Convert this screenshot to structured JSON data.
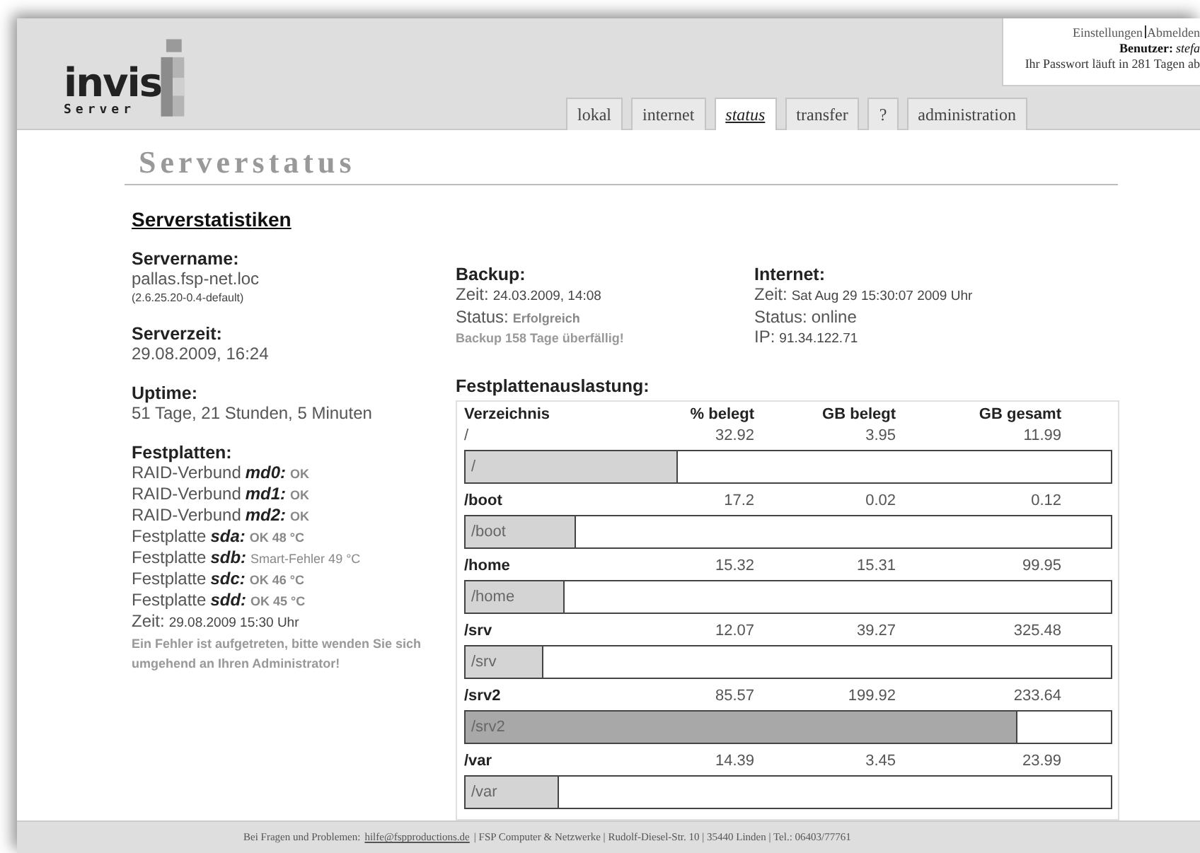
{
  "user_box": {
    "links": [
      "Einstellungen",
      "Abmelden"
    ],
    "user_label": "Benutzer:",
    "user_name": "stefa",
    "password_note": "Ihr Passwort läuft in 281 Tagen ab"
  },
  "logo": {
    "name": "invis",
    "sub": "Server"
  },
  "tabs": [
    {
      "label": "lokal",
      "selected": false
    },
    {
      "label": "internet",
      "selected": false
    },
    {
      "label": "status",
      "selected": true
    },
    {
      "label": "transfer",
      "selected": false
    },
    {
      "label": "?",
      "selected": false
    },
    {
      "label": "administration",
      "selected": false
    }
  ],
  "page_title": "Serverstatus",
  "section_title": "Serverstatistiken",
  "servername": {
    "heading": "Servername:",
    "value": "pallas.fsp-net.loc",
    "kernel": "(2.6.25.20-0.4-default)"
  },
  "serverzeit": {
    "heading": "Serverzeit:",
    "value": "29.08.2009, 16:24"
  },
  "uptime": {
    "heading": "Uptime:",
    "value": "51 Tage, 21 Stunden, 5 Minuten"
  },
  "disks": {
    "heading": "Festplatten:",
    "items": [
      {
        "label": "RAID-Verbund",
        "device": "md0:",
        "status": "OK",
        "error": false
      },
      {
        "label": "RAID-Verbund",
        "device": "md1:",
        "status": "OK",
        "error": false
      },
      {
        "label": "RAID-Verbund",
        "device": "md2:",
        "status": "OK",
        "error": false
      },
      {
        "label": "Festplatte",
        "device": "sda:",
        "status": "OK 48 °C",
        "error": false
      },
      {
        "label": "Festplatte",
        "device": "sdb:",
        "status": "Smart-Fehler 49 °C",
        "error": true
      },
      {
        "label": "Festplatte",
        "device": "sdc:",
        "status": "OK 46 °C",
        "error": false
      },
      {
        "label": "Festplatte",
        "device": "sdd:",
        "status": "OK 45 °C",
        "error": false
      }
    ],
    "time_label": "Zeit:",
    "time_value": "29.08.2009 15:30 Uhr",
    "error_message": "Ein Fehler ist aufgetreten, bitte wenden Sie sich umgehend an Ihren Administrator!"
  },
  "backup": {
    "heading": "Backup:",
    "time_label": "Zeit:",
    "time_value": "24.03.2009, 14:08",
    "status_label": "Status:",
    "status_value": "Erfolgreich",
    "warning": "Backup 158 Tage überfällig!"
  },
  "internet": {
    "heading": "Internet:",
    "time_label": "Zeit:",
    "time_value": "Sat Aug 29 15:30:07 2009 Uhr",
    "status_label": "Status:",
    "status_value": "online",
    "ip_label": "IP:",
    "ip_value": "91.34.122.71"
  },
  "usage": {
    "heading": "Festplattenauslastung:",
    "columns": [
      "Verzeichnis",
      "% belegt",
      "GB belegt",
      "GB gesamt"
    ],
    "rows": [
      {
        "dir": "/",
        "percent": "32.92",
        "used": "3.95",
        "total": "11.99",
        "bar_label": "/",
        "level": 0.3292,
        "alert": false,
        "bold": false
      },
      {
        "dir": "/boot",
        "percent": "17.2",
        "used": "0.02",
        "total": "0.12",
        "bar_label": "/boot",
        "level": 0.172,
        "alert": false,
        "bold": true
      },
      {
        "dir": "/home",
        "percent": "15.32",
        "used": "15.31",
        "total": "99.95",
        "bar_label": "/home",
        "level": 0.1532,
        "alert": false,
        "bold": true
      },
      {
        "dir": "/srv",
        "percent": "12.07",
        "used": "39.27",
        "total": "325.48",
        "bar_label": "/srv",
        "level": 0.1207,
        "alert": false,
        "bold": true
      },
      {
        "dir": "/srv2",
        "percent": "85.57",
        "used": "199.92",
        "total": "233.64",
        "bar_label": "/srv2",
        "level": 0.8557,
        "alert": true,
        "bold": true
      },
      {
        "dir": "/var",
        "percent": "14.39",
        "used": "3.45",
        "total": "23.99",
        "bar_label": "/var",
        "level": 0.1439,
        "alert": false,
        "bold": true
      }
    ]
  },
  "footer": {
    "prefix": "Bei Fragen und Problemen:",
    "email": "hilfe@fspproductions.de",
    "rest": "| FSP Computer & Netzwerke | Rudolf-Diesel-Str. 10 | 35440 Linden | Tel.: 06403/77761"
  }
}
